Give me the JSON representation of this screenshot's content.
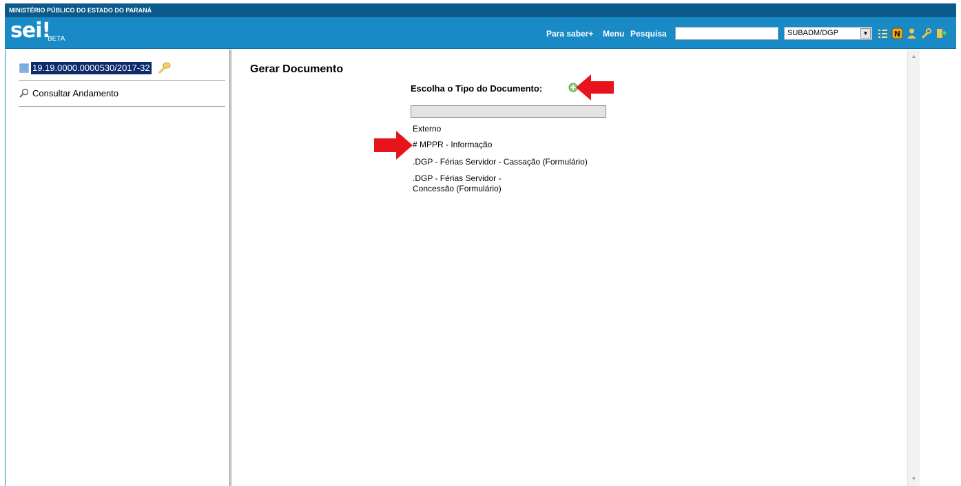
{
  "header": {
    "org_name": "MINISTÉRIO PÚBLICO DO ESTADO DO PARANÁ",
    "logo_text": "sei!",
    "logo_sub": "BETA",
    "links": {
      "para_saber": "Para saber+",
      "menu": "Menu",
      "pesquisa": "Pesquisa"
    },
    "search_value": "",
    "unit_selected": "SUBADM/DGP",
    "toolbar_icons": [
      "list-icon",
      "notes-icon",
      "user-icon",
      "wrench-icon",
      "exit-icon"
    ]
  },
  "tree": {
    "process_number": "19.19.0000.0000530/2017-32",
    "consult_label": "Consultar Andamento"
  },
  "main": {
    "title": "Gerar Documento",
    "choose_label": "Escolha o Tipo do Documento:",
    "filter_value": "",
    "document_types": [
      "Externo",
      "# MPPR - Informação",
      ".DGP - Férias Servidor - Cassação (Formulário)",
      ".DGP - Férias Servidor - Concessão (Formulário)"
    ]
  },
  "colors": {
    "header_dark": "#0b5a8c",
    "header_main": "#1a8ac6",
    "selection": "#0d2a6b",
    "annotation_arrow": "#e8141c"
  }
}
